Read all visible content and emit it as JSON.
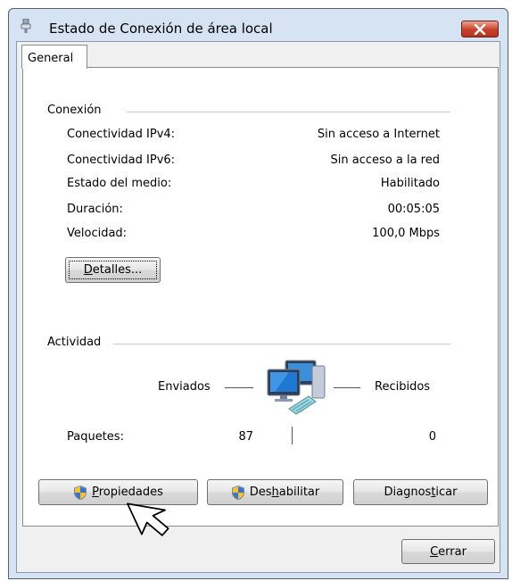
{
  "window": {
    "title": "Estado de Conexión de área local"
  },
  "tabs": [
    {
      "label": "General"
    }
  ],
  "connection": {
    "section_title": "Conexión",
    "rows": [
      {
        "label": "Conectividad IPv4:",
        "value": "Sin acceso a Internet"
      },
      {
        "label": "Conectividad IPv6:",
        "value": "Sin acceso a la red"
      },
      {
        "label": "Estado del medio:",
        "value": "Habilitado"
      },
      {
        "label": "Duración:",
        "value": "00:05:05"
      },
      {
        "label": "Velocidad:",
        "value": "100,0 Mbps"
      }
    ],
    "details_button": {
      "pre": "",
      "accel": "D",
      "post": "etalles..."
    }
  },
  "activity": {
    "section_title": "Actividad",
    "sent_label": "Enviados",
    "received_label": "Recibidos",
    "packets_label": "Paquetes:",
    "packets_sent": "87",
    "packets_received": "0"
  },
  "buttons": {
    "properties": {
      "pre": "",
      "accel": "P",
      "post": "ropiedades"
    },
    "disable": {
      "pre": "Des",
      "accel": "h",
      "post": "abilitar"
    },
    "diagnose": {
      "pre": "Diagnos",
      "accel": "t",
      "post": "icar"
    },
    "close": {
      "pre": "",
      "accel": "C",
      "post": "errar"
    }
  },
  "icons": {
    "title": "network-adapter-icon",
    "activity": "network-computers-icon",
    "shield": "uac-shield-icon",
    "cursor": "mouse-pointer-icon"
  },
  "colors": {
    "frame": "#d6e3f3",
    "close_button": "#c8402a",
    "panel": "#ffffff"
  }
}
